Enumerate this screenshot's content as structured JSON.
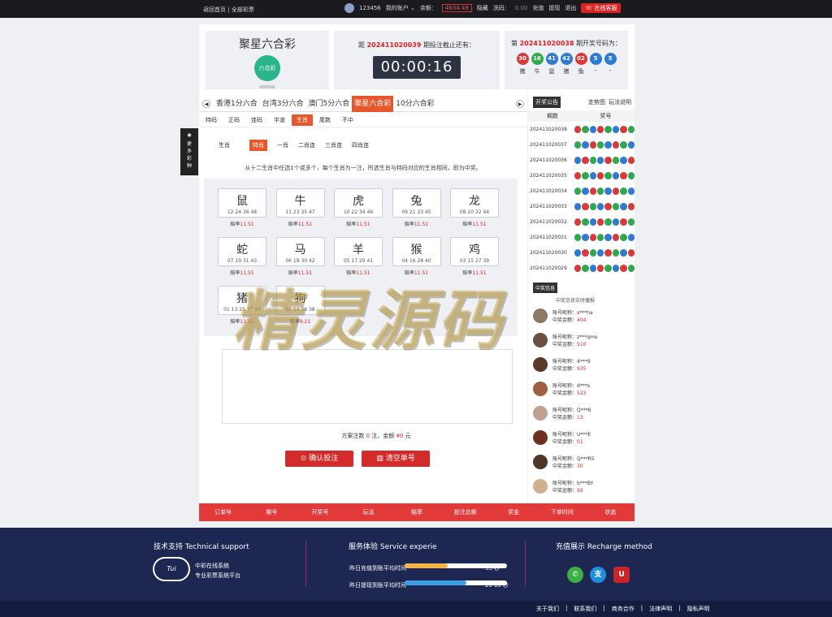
{
  "topbar": {
    "home": "返回首页",
    "sep": "|",
    "all_lottery": "全部彩票",
    "user": "123456",
    "my_account": "我的账户",
    "balance_label": "余额：",
    "balance_value": "4634.49",
    "hide": "隐藏",
    "points_label": "洗码：",
    "points_value": "0.00",
    "recharge": "充值",
    "withdraw": "提现",
    "logout": "退出",
    "online_service": "在线客服"
  },
  "game": {
    "title": "聚星六合彩",
    "logo_text": "六合彩"
  },
  "countdown": {
    "prefix": "距",
    "period": "202411020039",
    "suffix": "期投注截止还有：",
    "time": "00:00:16"
  },
  "result": {
    "prefix": "第",
    "period": "202411020038",
    "suffix": "期开奖号码为：",
    "balls": [
      {
        "n": "30",
        "color": "#d83a3a"
      },
      {
        "n": "16",
        "color": "#2fa84f"
      },
      {
        "n": "41",
        "color": "#2f7bd0"
      },
      {
        "n": "42",
        "color": "#2f7bd0"
      },
      {
        "n": "02",
        "color": "#d83a3a"
      },
      {
        "n": "5",
        "color": "#2f7bd0"
      },
      {
        "n": "5",
        "color": "#2f7bd0"
      }
    ],
    "zodiacs": [
      "猪",
      "牛",
      "鼠",
      "猪",
      "兔",
      "-",
      "-"
    ]
  },
  "game_tabs": [
    "香港1分六合",
    "台湾3分六合",
    "澳门5分六合",
    "聚星六合彩",
    "10分六合彩"
  ],
  "play_tabs": [
    "特码",
    "正码",
    "连码",
    "半波",
    "生肖",
    "尾数",
    "不中"
  ],
  "sub": {
    "label": "生肖",
    "tabs": [
      "特肖",
      "一肖",
      "二肖连",
      "三肖连",
      "四肖连"
    ]
  },
  "hint": "从十二生肖中任选1个或多个，每个生肖为一注，所选生肖与特码对应的生肖相同，即为中奖。",
  "zodiac_cells": [
    {
      "name": "鼠",
      "nums": "12 24 36 48",
      "odds_label": "赔率",
      "odds": "11.51"
    },
    {
      "name": "牛",
      "nums": "11 23 35 47",
      "odds_label": "赔率",
      "odds": "11.51"
    },
    {
      "name": "虎",
      "nums": "10 22 34 46",
      "odds_label": "赔率",
      "odds": "11.51"
    },
    {
      "name": "兔",
      "nums": "09 21 33 45",
      "odds_label": "赔率",
      "odds": "11.51"
    },
    {
      "name": "龙",
      "nums": "08 20 32 44",
      "odds_label": "赔率",
      "odds": "11.51"
    },
    {
      "name": "蛇",
      "nums": "07 19 31 43",
      "odds_label": "赔率",
      "odds": "11.51"
    },
    {
      "name": "马",
      "nums": "06 18 30 42",
      "odds_label": "赔率",
      "odds": "11.51"
    },
    {
      "name": "羊",
      "nums": "05 17 29 41",
      "odds_label": "赔率",
      "odds": "11.51"
    },
    {
      "name": "猴",
      "nums": "04 16 28 40",
      "odds_label": "赔率",
      "odds": "11.51"
    },
    {
      "name": "鸡",
      "nums": "03 15 27 39",
      "odds_label": "赔率",
      "odds": "11.51"
    },
    {
      "name": "猪",
      "nums": "01 13 25 37 49",
      "odds_label": "赔率",
      "odds": "11.51"
    },
    {
      "name": "狗",
      "nums": "02 14 26 38",
      "odds_label": "赔率",
      "odds": "9.21"
    }
  ],
  "summary": {
    "p1": "方案注数",
    "bets": "0",
    "p2": "注，金额",
    "amount": "¥0",
    "p3": "元"
  },
  "buttons": {
    "confirm": "确认投注",
    "clear": "清空单号"
  },
  "right": {
    "tab_open": "开奖公告",
    "tab_trend": "走势图",
    "tab_rules": "玩法说明",
    "col_period": "期数",
    "col_number": "奖号",
    "history": [
      "202411020038",
      "202411020037",
      "202411020036",
      "202411020035",
      "202411020034",
      "202411020033",
      "202411020032",
      "202411020031",
      "202411020030",
      "202411020029"
    ],
    "winners_label": "中奖信息",
    "winners_title": "中奖信息实时播报",
    "winners": [
      {
        "acct": "s***ha",
        "amt": "404"
      },
      {
        "acct": "z***qmo",
        "amt": "510"
      },
      {
        "acct": "4***9",
        "amt": "935"
      },
      {
        "acct": "d***s",
        "amt": "523"
      },
      {
        "acct": "Q***6",
        "amt": "13"
      },
      {
        "acct": "U***E",
        "amt": "01"
      },
      {
        "acct": "Q***R5",
        "amt": "30"
      },
      {
        "acct": "b***BY",
        "amt": "93"
      }
    ],
    "acct_label": "账号昵称：",
    "amt_label": "中奖金额："
  },
  "bottom_bar": [
    "订单号",
    "期号",
    "开奖号",
    "玩法",
    "赔率",
    "投注总额",
    "奖金",
    "下单时间",
    "状态"
  ],
  "side_more": "更多彩种",
  "footer": {
    "support_title": "技术支持 Technical support",
    "support_line1": "中彩在线系统",
    "support_line2": "专业彩票系统平台",
    "service_title": "服务体验 Service experie",
    "svc1_label": "昨日充值到账平均时间",
    "svc1_value": "53 秒",
    "svc1_pct": 0.42,
    "svc2_label": "昨日提现到账平均时间",
    "svc2_value": "20'18 秒",
    "svc2_pct": 0.6,
    "recharge_title": "充值展示 Recharge method",
    "links": [
      "关于我们",
      "联系我们",
      "商务合作",
      "法律声明",
      "隐私声明"
    ]
  },
  "watermark": "精灵源码",
  "colors": {
    "accent": "#e8572c",
    "red": "#d22",
    "footer": "#1d2752"
  }
}
